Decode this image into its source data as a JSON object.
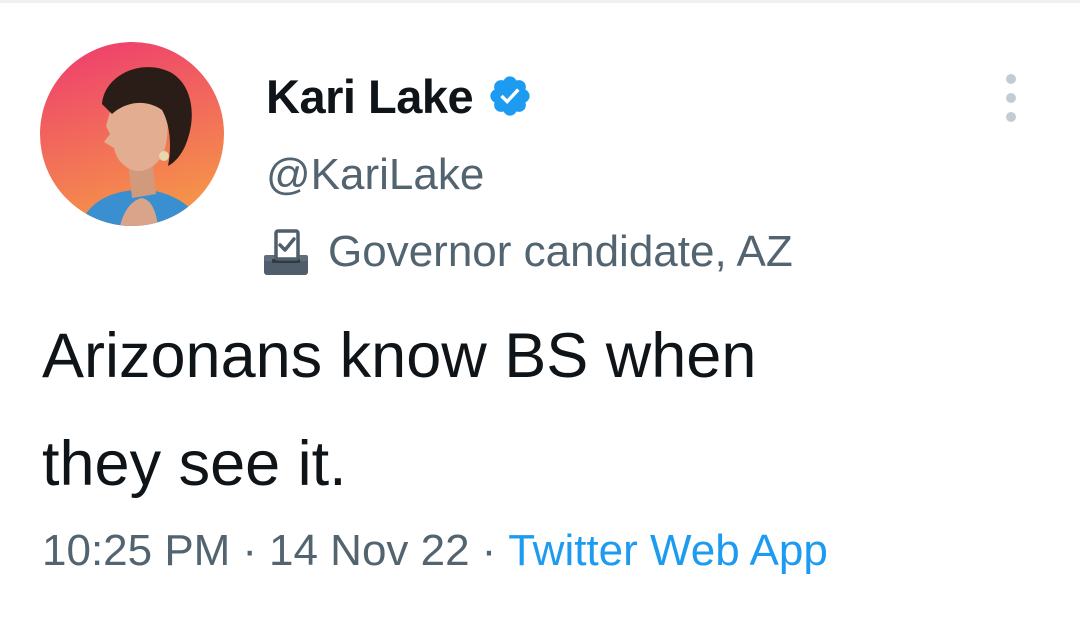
{
  "author": {
    "display_name": "Kari Lake",
    "handle": "@KariLake",
    "label": "Governor candidate, AZ",
    "verified": true
  },
  "tweet": {
    "text_line1": "Arizonans know BS when",
    "text_line2": "they see it.",
    "time": "10:25 PM",
    "date": "14 Nov 22",
    "source": "Twitter Web App",
    "separator": "·"
  },
  "colors": {
    "text_primary": "#0f1419",
    "text_secondary": "#536471",
    "link": "#1d9bf0",
    "verified_badge": "#1d9bf0",
    "avatar_background_top": "#ef3d6b",
    "avatar_background_bottom": "#f58a4a"
  },
  "icons": {
    "verified": "verified-badge-icon",
    "label": "ballot-box-icon",
    "more": "more-options-icon"
  }
}
